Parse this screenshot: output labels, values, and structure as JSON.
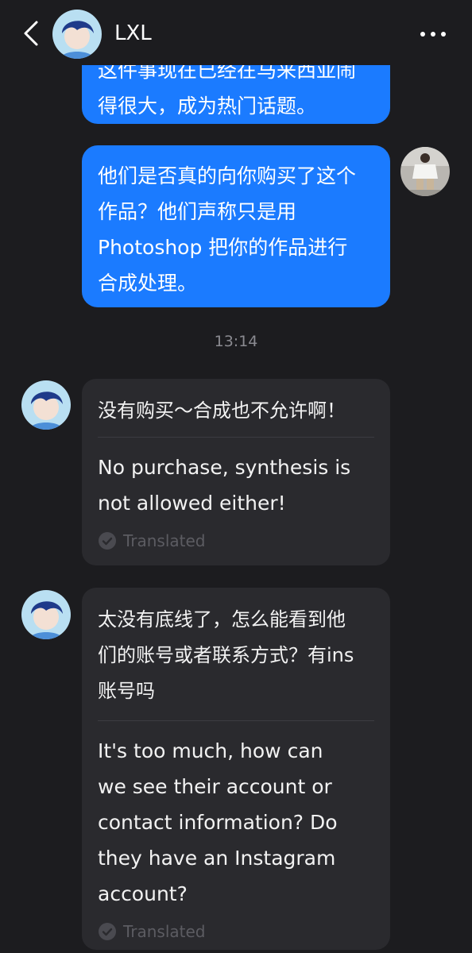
{
  "header": {
    "contact_name": "LXL",
    "back_icon": "chevron-left-icon",
    "more_icon": "more-horizontal-icon"
  },
  "messages": {
    "m1": {
      "direction": "outgoing",
      "text_partial": "这件事现在已经在马来西亚闹",
      "text": "得很大，成为热门话题。"
    },
    "m2": {
      "direction": "outgoing",
      "text": "他们是否真的向你购买了这个\n作品？他们声称只是用\nPhotoshop 把你的作品进行\n合成处理。"
    },
    "timestamp": "13:14",
    "m3": {
      "direction": "incoming",
      "original": "没有购买～合成也不允许啊！",
      "translation": "No purchase, synthesis is\nnot allowed either!",
      "translated_label": "Translated"
    },
    "m4": {
      "direction": "incoming",
      "original": "太没有底线了，怎么能看到他\n们的账号或者联系方式？有ins\n账号吗",
      "translation": "It's too much, how can\nwe see their account or\ncontact information? Do\nthey have an Instagram\naccount?",
      "translated_label": "Translated"
    }
  },
  "colors": {
    "background": "#1c1c1f",
    "outgoing_bubble": "#1b7bff",
    "incoming_bubble": "#2a2a2e",
    "timestamp_text": "#8a8a90",
    "translated_label": "#5c5c62"
  }
}
